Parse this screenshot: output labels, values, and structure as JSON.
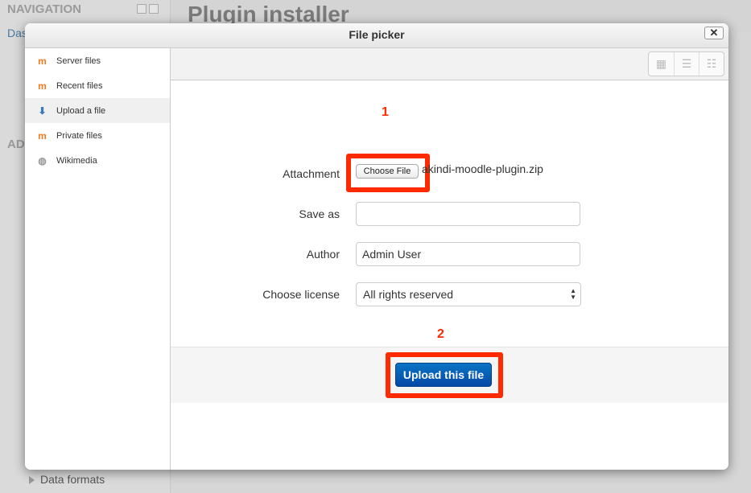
{
  "background": {
    "nav_title": "NAVIGATION",
    "dashboard_link": "Das",
    "admin_title": "AD",
    "data_formats": "Data formats",
    "page_title": "Plugin installer"
  },
  "dialog": {
    "title": "File picker",
    "close_label": "✕",
    "sidebar": [
      {
        "label": "Server files",
        "icon": "moodle-icon"
      },
      {
        "label": "Recent files",
        "icon": "moodle-icon"
      },
      {
        "label": "Upload a file",
        "icon": "upload-icon",
        "active": true
      },
      {
        "label": "Private files",
        "icon": "moodle-icon"
      },
      {
        "label": "Wikimedia",
        "icon": "wikimedia-icon"
      }
    ],
    "view_buttons": [
      "icons-view",
      "list-view",
      "tree-view"
    ],
    "form": {
      "attachment_label": "Attachment",
      "choose_file_label": "Choose File",
      "file_name": "akindi-moodle-plugin.zip",
      "save_as_label": "Save as",
      "save_as_value": "",
      "author_label": "Author",
      "author_value": "Admin User",
      "license_label": "Choose license",
      "license_value": "All rights reserved",
      "upload_label": "Upload this file"
    },
    "annotations": [
      "1",
      "2"
    ],
    "highlight_color": "#ff2a00",
    "accent_color": "#0a5fb4"
  }
}
